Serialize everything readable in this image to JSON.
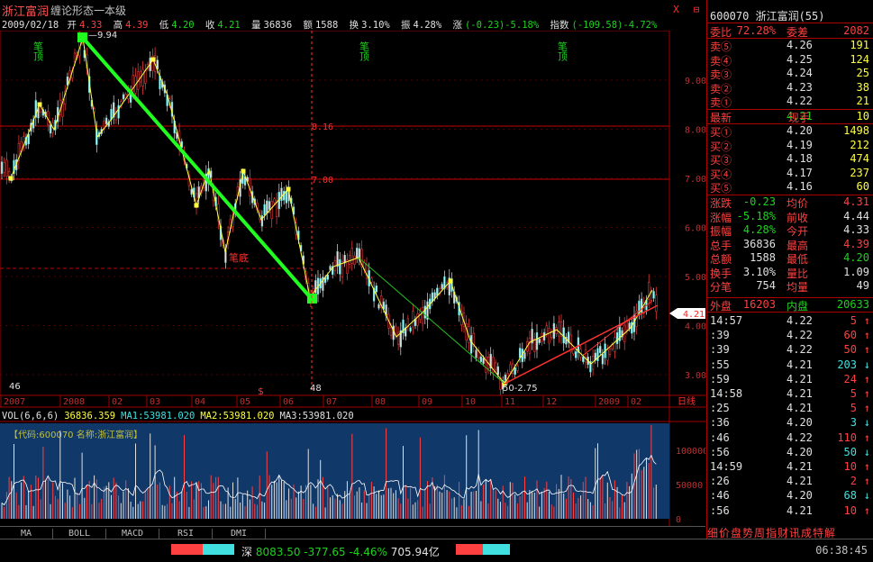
{
  "title": {
    "name": "浙江富润",
    "indicator": "缠论形态一本级"
  },
  "window_buttons": [
    "X",
    "⊟"
  ],
  "info": {
    "date": "2009/02/18",
    "open_label": "开",
    "open": "4.33",
    "high_label": "高",
    "high": "4.39",
    "low_label": "低",
    "low": "4.20",
    "close_label": "收",
    "close": "4.21",
    "vol_label": "量",
    "vol": "36836",
    "amt_label": "额",
    "amt": "1588",
    "turn_label": "换",
    "turn": "3.10%",
    "amp_label": "振",
    "amp": "4.28%",
    "chg_label": "涨",
    "chg": "(-0.23)-5.18%",
    "index_label": "指数",
    "index": "(-109.58)-4.72%"
  },
  "chart": {
    "price_ticks": [
      "9.00",
      "8.00",
      "7.00",
      "6.00",
      "5.00",
      "4.00",
      "3.00"
    ],
    "hlines": [
      "8.16",
      "7.00"
    ],
    "months": [
      "2007",
      "2008",
      "02",
      "03",
      "04",
      "05",
      "06",
      "07",
      "08",
      "09",
      "10",
      "11",
      "12",
      "2009",
      "02"
    ],
    "period": "日线",
    "annotations": {
      "top_label": "笔顶",
      "bottom_label": "笔底",
      "high_mark": "9.94",
      "low_mark": "2.75",
      "bar46": "46",
      "bar48": "48",
      "bar50": "50",
      "dollar": "$",
      "last_price": "4.21"
    }
  },
  "volume": {
    "title": "VOL(6,6,6)",
    "vol": "36836.359",
    "ma1": "MA1:53981.020",
    "ma2": "MA2:53981.020",
    "ma3": "MA3:53981.020",
    "code_text": "【代码:600070 名称:浙江富润】",
    "ticks": [
      "100000",
      "50000",
      "0"
    ]
  },
  "tabs": [
    "MA",
    "BOLL",
    "MACD",
    "RSI",
    "DMI"
  ],
  "status": {
    "market": "深",
    "index": "8083.50",
    "change": "-377.65",
    "pct": "-4.46%",
    "amount": "705.94亿",
    "time": "06:38:45"
  },
  "panel": {
    "code": "600070",
    "name": "浙江富润(55)",
    "webi_label": "委比",
    "webi": "72.28%",
    "weicha_label": "委差",
    "weicha": "2082",
    "sells": [
      {
        "label": "卖⑤",
        "price": "4.26",
        "vol": "191"
      },
      {
        "label": "卖④",
        "price": "4.25",
        "vol": "124"
      },
      {
        "label": "卖③",
        "price": "4.24",
        "vol": "25"
      },
      {
        "label": "卖②",
        "price": "4.23",
        "vol": "38"
      },
      {
        "label": "卖①",
        "price": "4.22",
        "vol": "21"
      }
    ],
    "latest_label": "最新",
    "latest": "4.21",
    "xianshou_label": "现手",
    "xianshou": "10",
    "buys": [
      {
        "label": "买①",
        "price": "4.20",
        "vol": "1498"
      },
      {
        "label": "买②",
        "price": "4.19",
        "vol": "212"
      },
      {
        "label": "买③",
        "price": "4.18",
        "vol": "474"
      },
      {
        "label": "买④",
        "price": "4.17",
        "vol": "237"
      },
      {
        "label": "买⑤",
        "price": "4.16",
        "vol": "60"
      }
    ],
    "stats": [
      {
        "l1": "涨跌",
        "v1": "-0.23",
        "l2": "均价",
        "v2": "4.31"
      },
      {
        "l1": "涨幅",
        "v1": "-5.18%",
        "l2": "前收",
        "v2": "4.44"
      },
      {
        "l1": "振幅",
        "v1": "4.28%",
        "l2": "今开",
        "v2": "4.33"
      },
      {
        "l1": "总手",
        "v1": "36836",
        "l2": "最高",
        "v2": "4.39"
      },
      {
        "l1": "总额",
        "v1": "1588",
        "l2": "最低",
        "v2": "4.20"
      },
      {
        "l1": "换手",
        "v1": "3.10%",
        "l2": "量比",
        "v2": "1.09"
      },
      {
        "l1": "分笔",
        "v1": "754",
        "l2": "均量",
        "v2": "49"
      }
    ],
    "waipan_label": "外盘",
    "waipan": "16203",
    "neipan_label": "内盘",
    "neipan": "20633",
    "ticks": [
      {
        "time": "14:57",
        "price": "4.22",
        "vol": "5",
        "dir": "up"
      },
      {
        "time": ":39",
        "price": "4.22",
        "vol": "60",
        "dir": "up"
      },
      {
        "time": ":39",
        "price": "4.22",
        "vol": "50",
        "dir": "up"
      },
      {
        "time": ":55",
        "price": "4.21",
        "vol": "203",
        "dir": "dn"
      },
      {
        "time": ":59",
        "price": "4.21",
        "vol": "24",
        "dir": "up"
      },
      {
        "time": "14:58",
        "price": "4.21",
        "vol": "5",
        "dir": "up"
      },
      {
        "time": ":25",
        "price": "4.21",
        "vol": "5",
        "dir": "up"
      },
      {
        "time": ":36",
        "price": "4.20",
        "vol": "3",
        "dir": "dn"
      },
      {
        "time": ":46",
        "price": "4.22",
        "vol": "110",
        "dir": "up"
      },
      {
        "time": ":56",
        "price": "4.20",
        "vol": "50",
        "dir": "dn"
      },
      {
        "time": "14:59",
        "price": "4.21",
        "vol": "10",
        "dir": "up"
      },
      {
        "time": ":26",
        "price": "4.21",
        "vol": "2",
        "dir": "up"
      },
      {
        "time": ":46",
        "price": "4.20",
        "vol": "68",
        "dir": "dn"
      },
      {
        "time": ":56",
        "price": "4.21",
        "vol": "10",
        "dir": "up"
      }
    ],
    "footer": "细价盘势周指财讯成特解"
  }
}
